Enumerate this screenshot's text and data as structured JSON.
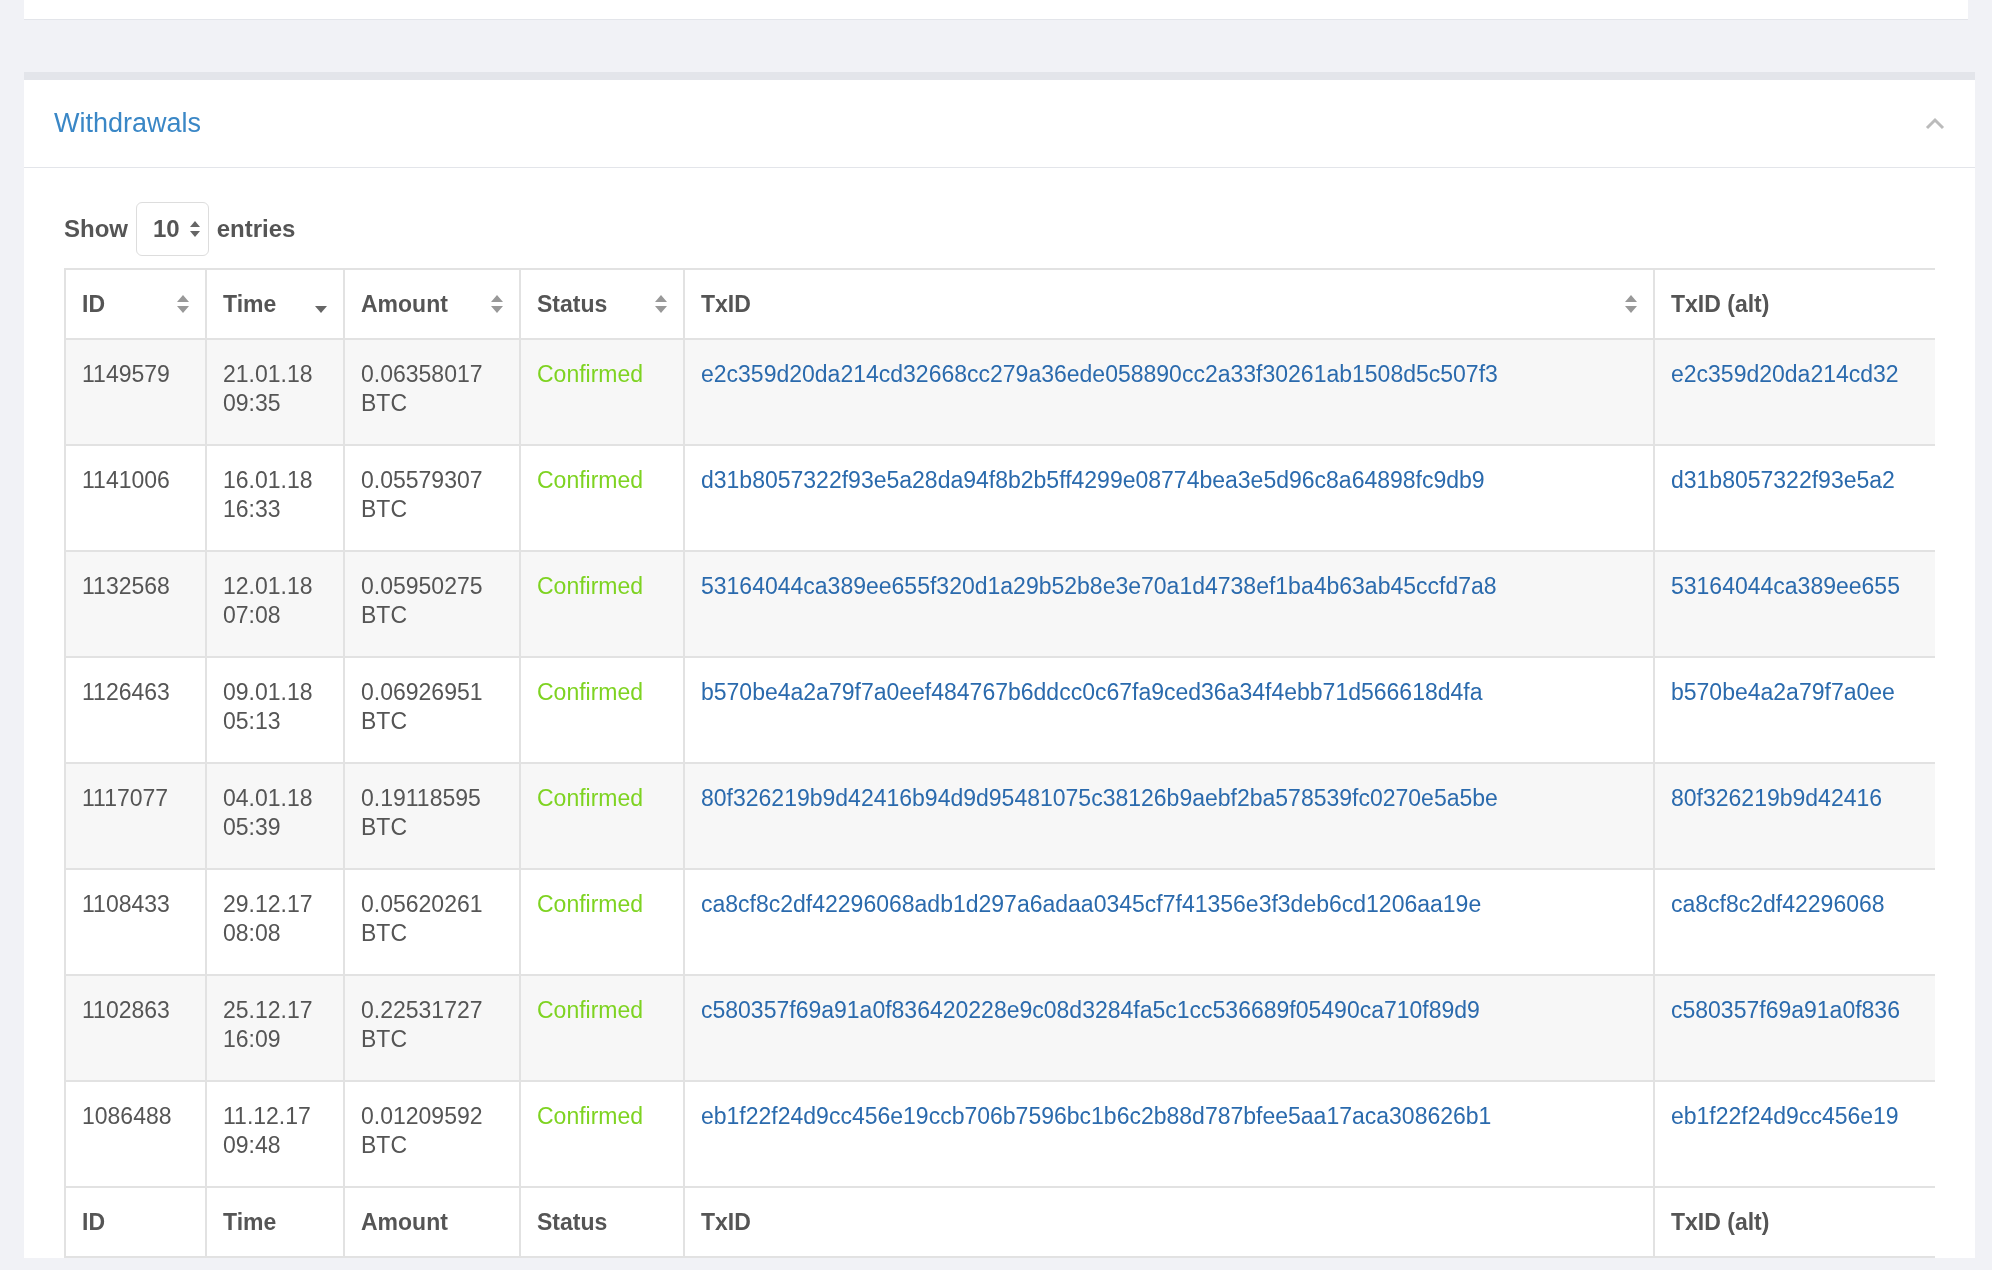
{
  "panel": {
    "title": "Withdrawals",
    "expanded": true
  },
  "length_menu": {
    "before": "Show",
    "value": "10",
    "after": "entries"
  },
  "table": {
    "columns": [
      {
        "label": "ID",
        "kind": "sortable"
      },
      {
        "label": "Time",
        "kind": "descending"
      },
      {
        "label": "Amount",
        "kind": "sortable"
      },
      {
        "label": "Status",
        "kind": "sortable"
      },
      {
        "label": "TxID",
        "kind": "sortable"
      },
      {
        "label": "TxID (alt)",
        "kind": "plain"
      }
    ],
    "rows": [
      {
        "id": "1149579",
        "time": "21.01.18 09:35",
        "amount": "0.06358017 BTC",
        "status": "Confirmed",
        "kind": "confirmed",
        "txid": "e2c359d20da214cd32668cc279a36ede058890cc2a33f30261ab1508d5c507f3",
        "txid_alt": "e2c359d20da214cd32"
      },
      {
        "id": "1141006",
        "time": "16.01.18 16:33",
        "amount": "0.05579307 BTC",
        "status": "Confirmed",
        "kind": "confirmed",
        "txid": "d31b8057322f93e5a28da94f8b2b5ff4299e08774bea3e5d96c8a64898fc9db9",
        "txid_alt": "d31b8057322f93e5a2"
      },
      {
        "id": "1132568",
        "time": "12.01.18 07:08",
        "amount": "0.05950275 BTC",
        "status": "Confirmed",
        "kind": "confirmed",
        "txid": "53164044ca389ee655f320d1a29b52b8e3e70a1d4738ef1ba4b63ab45ccfd7a8",
        "txid_alt": "53164044ca389ee655"
      },
      {
        "id": "1126463",
        "time": "09.01.18 05:13",
        "amount": "0.06926951 BTC",
        "status": "Confirmed",
        "kind": "confirmed",
        "txid": "b570be4a2a79f7a0eef484767b6ddcc0c67fa9ced36a34f4ebb71d566618d4fa",
        "txid_alt": "b570be4a2a79f7a0ee"
      },
      {
        "id": "1117077",
        "time": "04.01.18 05:39",
        "amount": "0.19118595 BTC",
        "status": "Confirmed",
        "kind": "confirmed",
        "txid": "80f326219b9d42416b94d9d95481075c38126b9aebf2ba578539fc0270e5a5be",
        "txid_alt": "80f326219b9d42416"
      },
      {
        "id": "1108433",
        "time": "29.12.17 08:08",
        "amount": "0.05620261 BTC",
        "status": "Confirmed",
        "kind": "confirmed",
        "txid": "ca8cf8c2df42296068adb1d297a6adaa0345cf7f41356e3f3deb6cd1206aa19e",
        "txid_alt": "ca8cf8c2df42296068"
      },
      {
        "id": "1102863",
        "time": "25.12.17 16:09",
        "amount": "0.22531727 BTC",
        "status": "Confirmed",
        "kind": "confirmed",
        "txid": "c580357f69a91a0f836420228e9c08d3284fa5c1cc536689f05490ca710f89d9",
        "txid_alt": "c580357f69a91a0f836"
      },
      {
        "id": "1086488",
        "time": "11.12.17 09:48",
        "amount": "0.01209592 BTC",
        "status": "Confirmed",
        "kind": "confirmed",
        "txid": "eb1f22f24d9cc456e19ccb706b7596bc1b6c2b88d787bfee5aa17aca308626b1",
        "txid_alt": "eb1f22f24d9cc456e19"
      }
    ],
    "footer": [
      "ID",
      "Time",
      "Amount",
      "Status",
      "TxID",
      "TxID (alt)"
    ]
  }
}
